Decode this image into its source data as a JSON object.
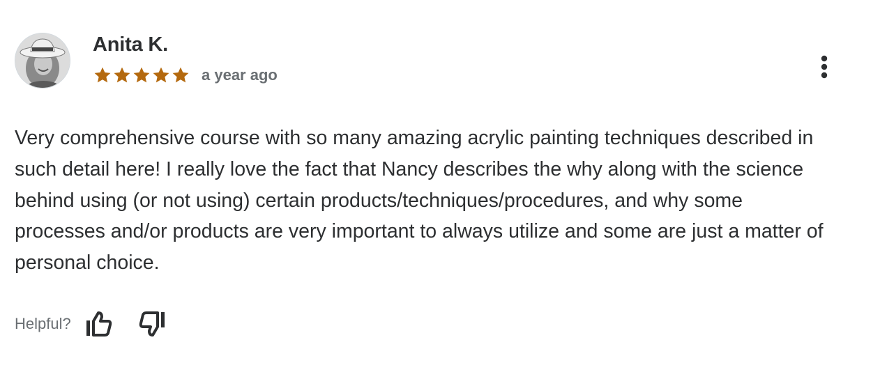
{
  "review": {
    "reviewer_name": "Anita K.",
    "rating": 5,
    "rating_max": 5,
    "star_color": "#b4690e",
    "timestamp": "a year ago",
    "body": "Very comprehensive course with so many amazing acrylic painting techniques described in such detail here! I really love the fact that Nancy describes the why along with the science behind using (or not using) certain products/techniques/procedures, and why some processes and/or products are very important to always utilize and some are just a matter of personal choice.",
    "avatar_icon": "user-photo-avatar",
    "more_icon": "vertical-ellipsis-icon"
  },
  "helpful": {
    "label": "Helpful?",
    "thumbs_up_icon": "thumbs-up-icon",
    "thumbs_down_icon": "thumbs-down-icon"
  }
}
